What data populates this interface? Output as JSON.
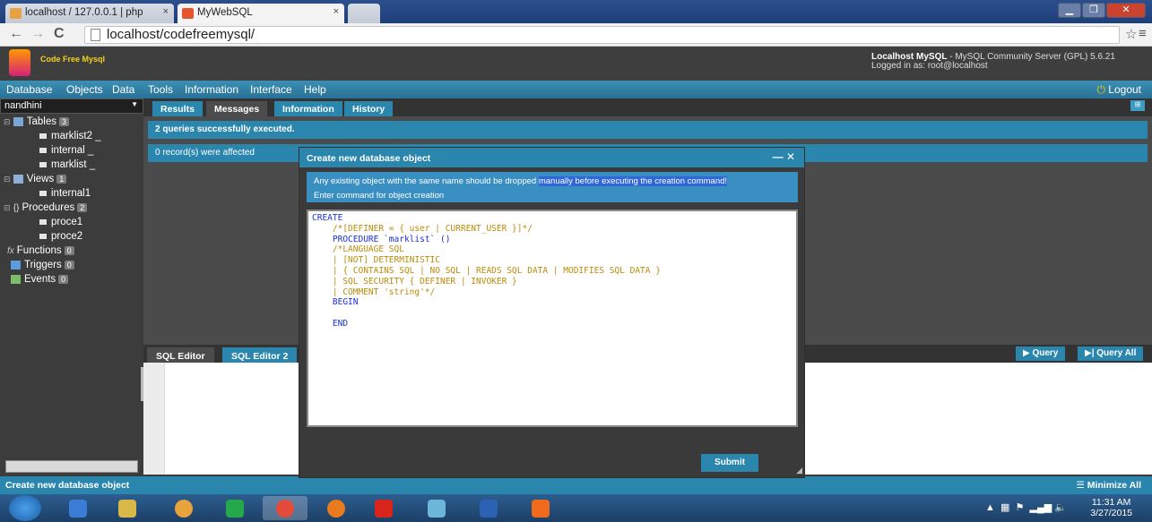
{
  "browser": {
    "tabs": [
      {
        "label": "localhost / 127.0.0.1 | php",
        "close": "×"
      },
      {
        "label": "MyWebSQL",
        "close": "×"
      }
    ],
    "url": "localhost/codefreemysql/",
    "window_controls": [
      "▁",
      "❐",
      "✕"
    ]
  },
  "app": {
    "logo_text": "Code Free Mysql",
    "server_name": "Localhost MySQL",
    "server_desc": " - MySQL Community Server (GPL) 5.6.21",
    "logged_in": "Logged in as: root@localhost"
  },
  "menu": {
    "items": [
      "Database",
      "Objects",
      "Data",
      "Tools",
      "Information",
      "Interface",
      "Help"
    ],
    "logout": "Logout"
  },
  "sidebar": {
    "db_select": "nandhini",
    "tables_label": "Tables",
    "tables_count": "3",
    "tables": [
      "marklist2",
      "internal",
      "marklist"
    ],
    "views_label": "Views",
    "views_count": "1",
    "views": [
      "internal1"
    ],
    "procedures_label": "Procedures",
    "procedures_count": "2",
    "procedures": [
      "proce1",
      "proce2"
    ],
    "functions_label": "Functions",
    "functions_count": "0",
    "triggers_label": "Triggers",
    "triggers_count": "0",
    "events_label": "Events",
    "events_count": "0"
  },
  "results": {
    "tabs": [
      "Results",
      "Messages",
      "Information",
      "History"
    ],
    "selected_tab": "Messages",
    "msg1": "2 queries successfully executed.",
    "msg2": "0 record(s) were affected"
  },
  "editor": {
    "tabs": [
      "SQL Editor",
      "SQL Editor 2"
    ],
    "query_btn": "Query",
    "query_all_btn": "Query All"
  },
  "dialog": {
    "title": "Create new database object",
    "controls": "—  ✕",
    "note_part1": "Any existing object with the same name should be dropped ",
    "note_highlight": "manually before executing the creation command!",
    "note_line2": "Enter command for object creation",
    "code": {
      "l1": "CREATE",
      "l2": "    /*[DEFINER = { user | CURRENT_USER }]*/",
      "l3": "    PROCEDURE `marklist` ()",
      "l4": "    /*LANGUAGE SQL",
      "l5": "    | [NOT] DETERMINISTIC",
      "l6": "    | { CONTAINS SQL | NO SQL | READS SQL DATA | MODIFIES SQL DATA }",
      "l7": "    | SQL SECURITY { DEFINER | INVOKER }",
      "l8": "    | COMMENT 'string'*/",
      "l9": "    BEGIN",
      "l10": "",
      "l11": "    END"
    },
    "submit": "Submit"
  },
  "statusbar": {
    "left": "Create new database object",
    "right": "Minimize All"
  },
  "taskbar": {
    "time": "11:31 AM",
    "date": "3/27/2015"
  },
  "colors": {
    "accent": "#2b86ad",
    "header_bg": "#3e3e3e",
    "logo_text": "#f3d11a"
  }
}
